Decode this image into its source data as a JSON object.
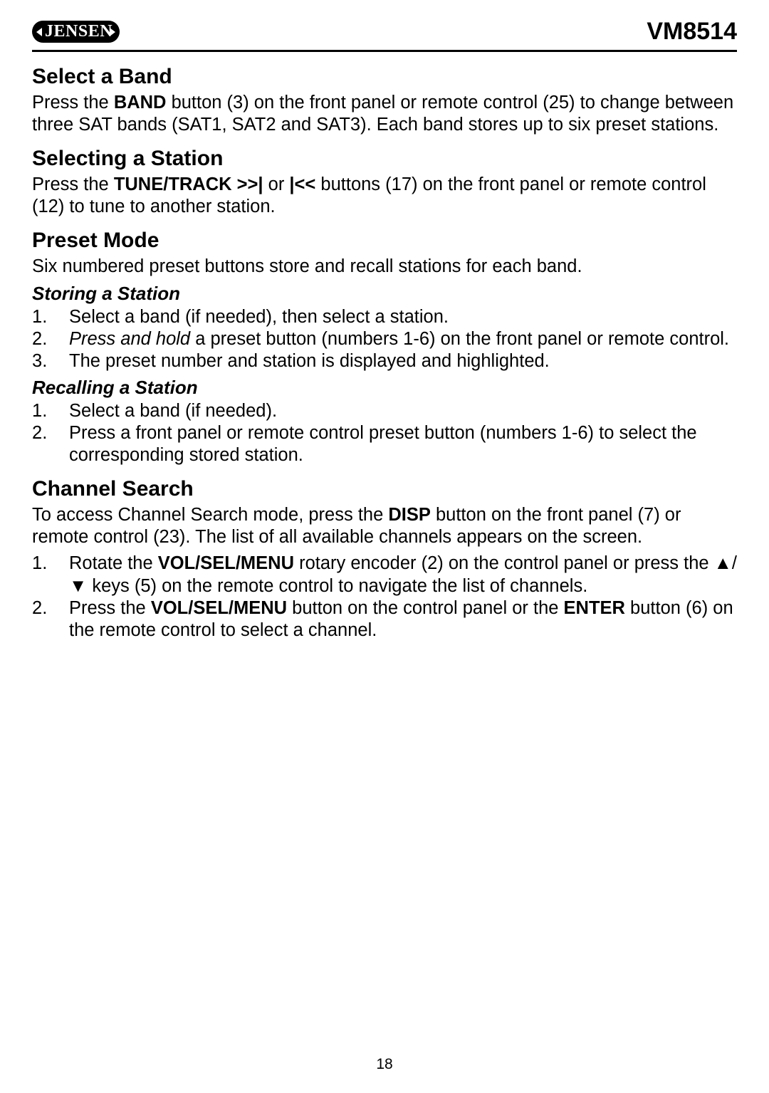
{
  "header": {
    "brand": "JENSEN",
    "model": "VM8514"
  },
  "sections": {
    "selectBand": {
      "title": "Select a Band",
      "text_pre": "Press the ",
      "text_bold": "BAND",
      "text_post": " button (3) on the front panel or remote control (25) to change between three SAT bands (SAT1, SAT2 and SAT3). Each band stores up to six preset stations."
    },
    "selectStation": {
      "title": "Selecting a Station",
      "text_pre": "Press the ",
      "text_bold1": "TUNE/TRACK >>|",
      "text_mid": " or ",
      "text_bold2": "|<<",
      "text_post": " buttons (17) on the front panel or remote control (12) to tune to another station."
    },
    "presetMode": {
      "title": "Preset Mode",
      "intro": "Six numbered preset buttons store and recall stations for each band.",
      "storing": {
        "heading": "Storing a Station",
        "steps": {
          "s1": "Select a band (if needed), then select a station.",
          "s2_italic": "Press and hold",
          "s2_rest": " a preset button (numbers 1-6) on the front panel or remote control.",
          "s3": "The preset number and station is displayed and highlighted."
        }
      },
      "recalling": {
        "heading": "Recalling a Station",
        "steps": {
          "r1": "Select a band (if needed).",
          "r2": "Press a front panel or remote control preset button (numbers 1-6) to select the corresponding stored station."
        }
      }
    },
    "channelSearch": {
      "title": "Channel Search",
      "intro_pre": "To access Channel Search mode, press the ",
      "intro_bold": "DISP",
      "intro_post": " button on the front panel (7) or remote control (23). The list of all available channels appears on the screen.",
      "steps": {
        "c1_pre": "Rotate the ",
        "c1_bold1": "VOL/SEL/MENU",
        "c1_mid": " rotary encoder (2) on the control panel or press the ",
        "c1_arrows": "▲/▼",
        "c1_post": " keys (5) on the remote control to navigate the list of chan­nels.",
        "c2_pre": "Press the ",
        "c2_bold1": "VOL/SEL/MENU",
        "c2_mid": " button on the control panel or the ",
        "c2_bold2": "ENTER",
        "c2_post": " button (6) on the remote control to select a channel."
      }
    }
  },
  "pageNumber": "18"
}
